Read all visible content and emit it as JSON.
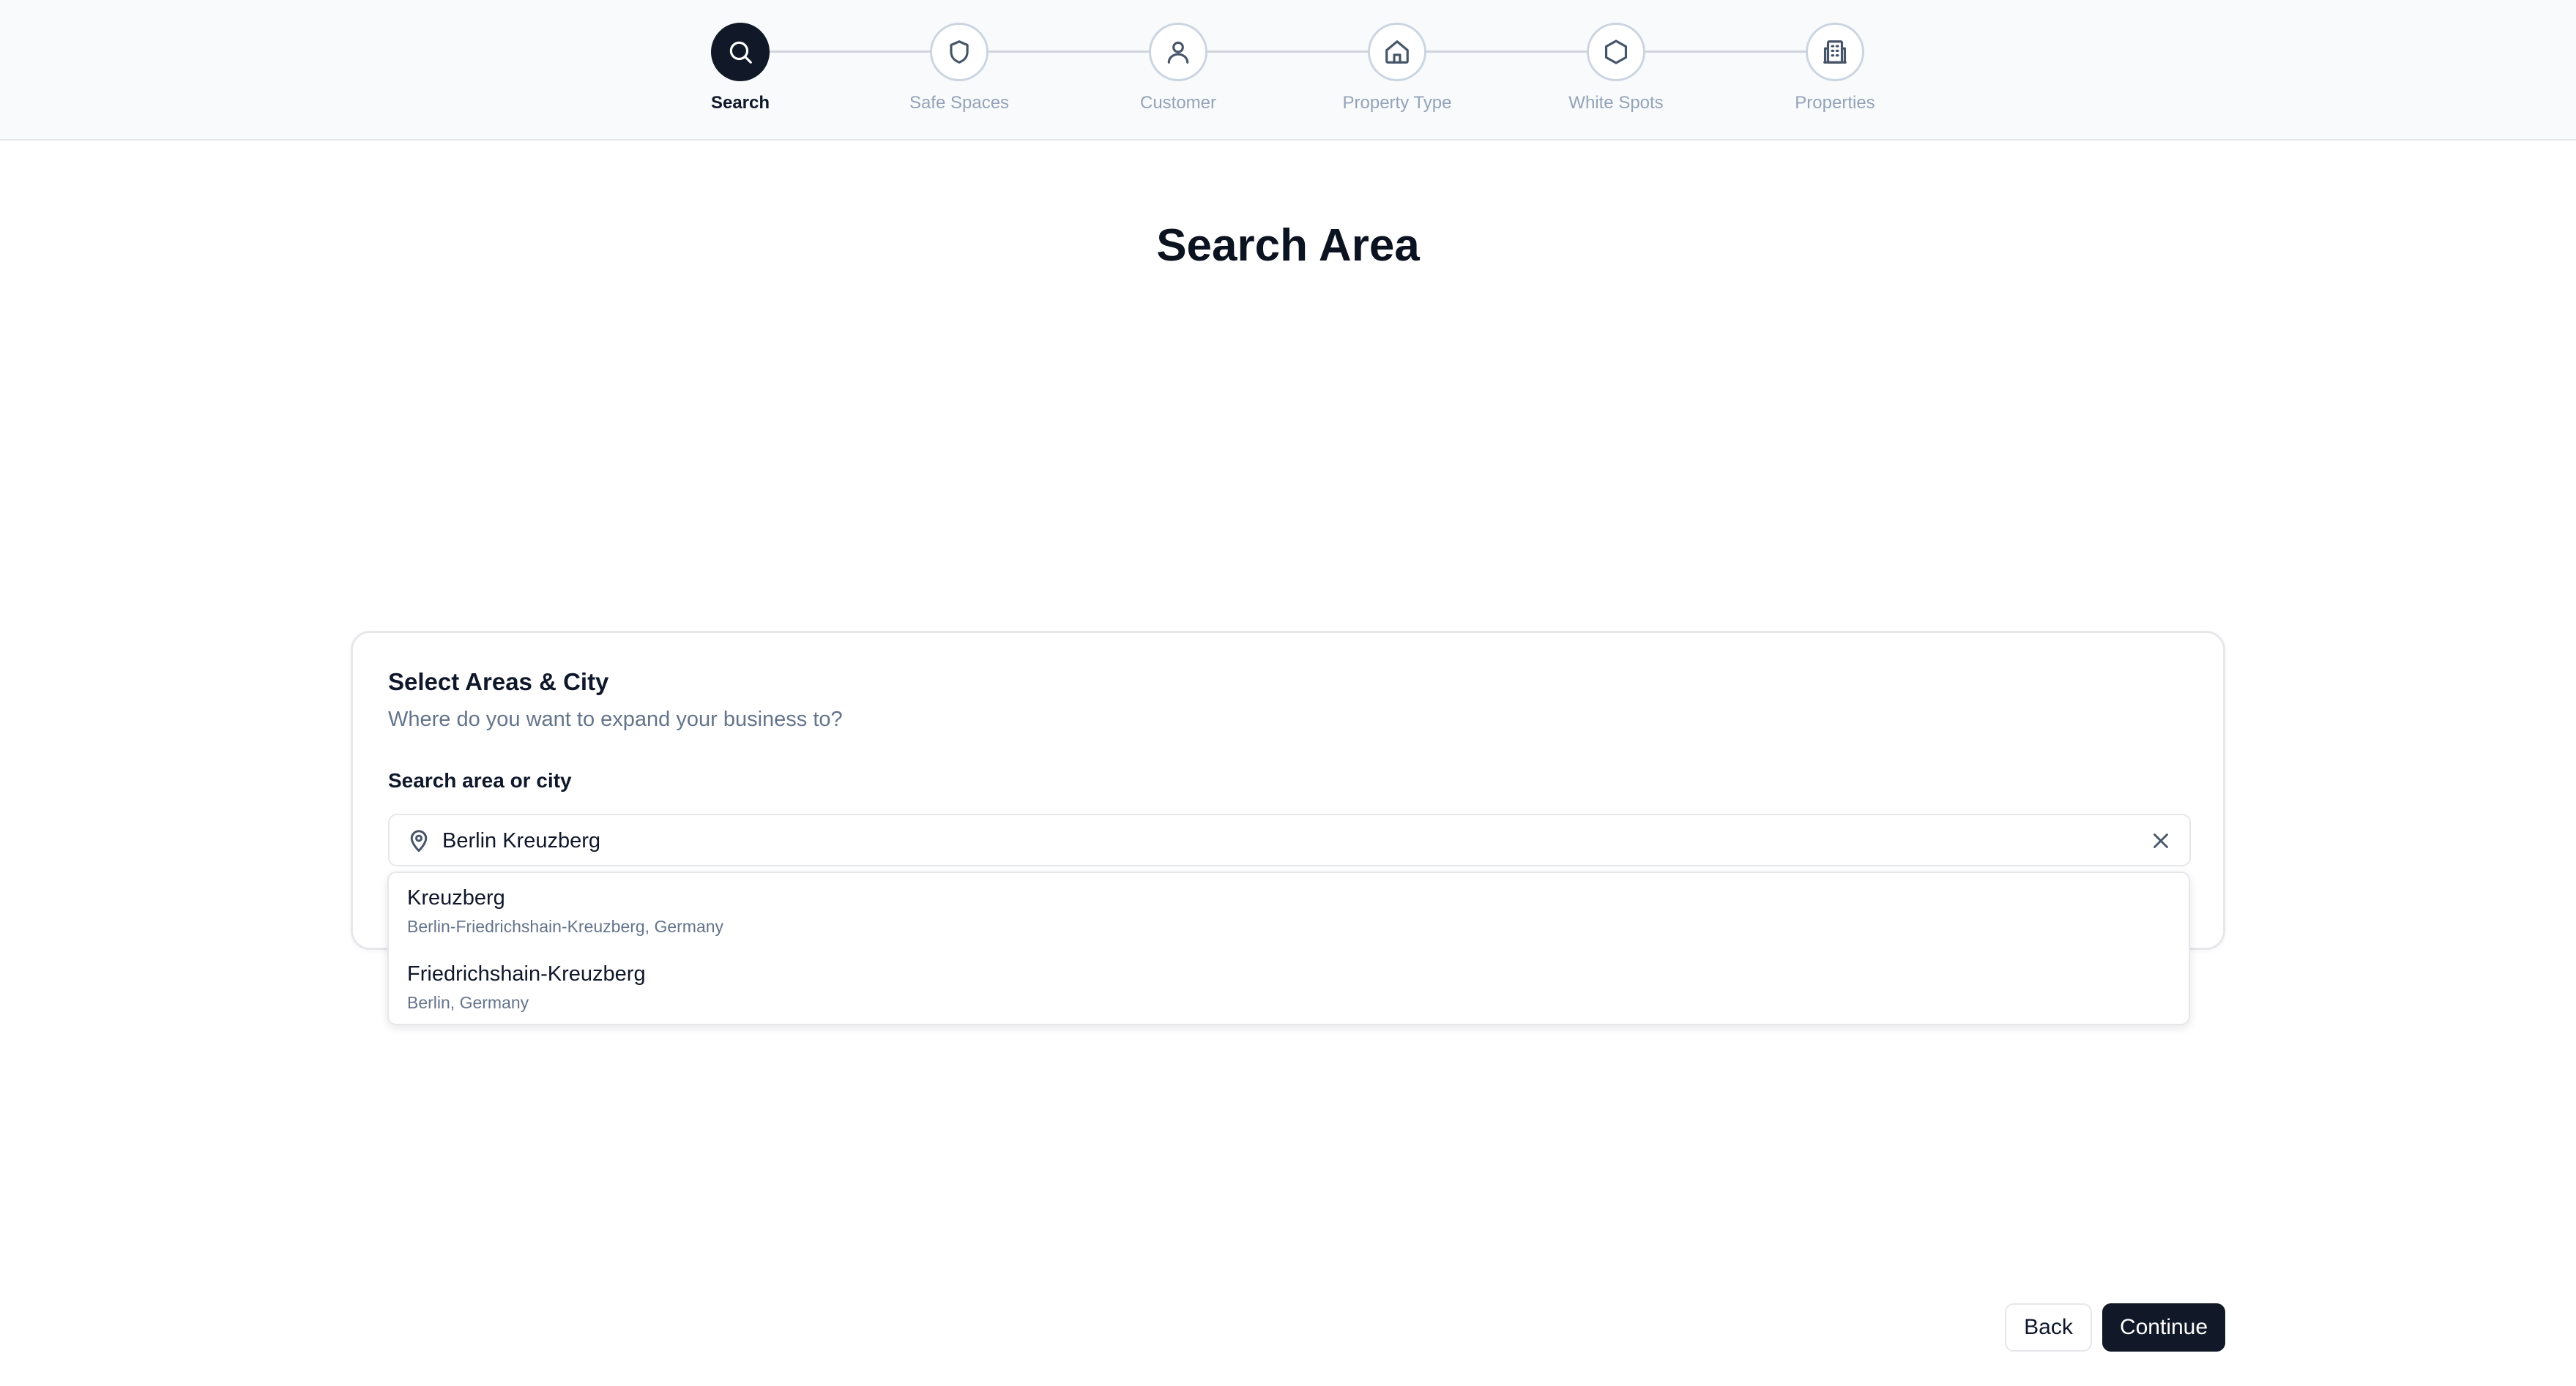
{
  "stepper": {
    "steps": [
      {
        "label": "Search",
        "icon": "search-icon",
        "active": true
      },
      {
        "label": "Safe Spaces",
        "icon": "shield-icon",
        "active": false
      },
      {
        "label": "Customer",
        "icon": "user-icon",
        "active": false
      },
      {
        "label": "Property Type",
        "icon": "house-icon",
        "active": false
      },
      {
        "label": "White Spots",
        "icon": "hexagon-icon",
        "active": false
      },
      {
        "label": "Properties",
        "icon": "building-icon",
        "active": false
      }
    ]
  },
  "page": {
    "title": "Search Area"
  },
  "card": {
    "title": "Select Areas & City",
    "subtitle": "Where do you want to expand your business to?",
    "field_label": "Search area or city",
    "search_value": "Berlin Kreuzberg"
  },
  "suggestions": [
    {
      "title": "Kreuzberg",
      "subtitle": "Berlin-Friedrichshain-Kreuzberg, Germany"
    },
    {
      "title": "Friedrichshain-Kreuzberg",
      "subtitle": "Berlin, Germany"
    }
  ],
  "actions": {
    "back_label": "Back",
    "continue_label": "Continue"
  },
  "colors": {
    "primary": "#111827",
    "muted_text": "#64748b",
    "border": "#e5e7eb",
    "header_bg": "#f8fafc"
  }
}
